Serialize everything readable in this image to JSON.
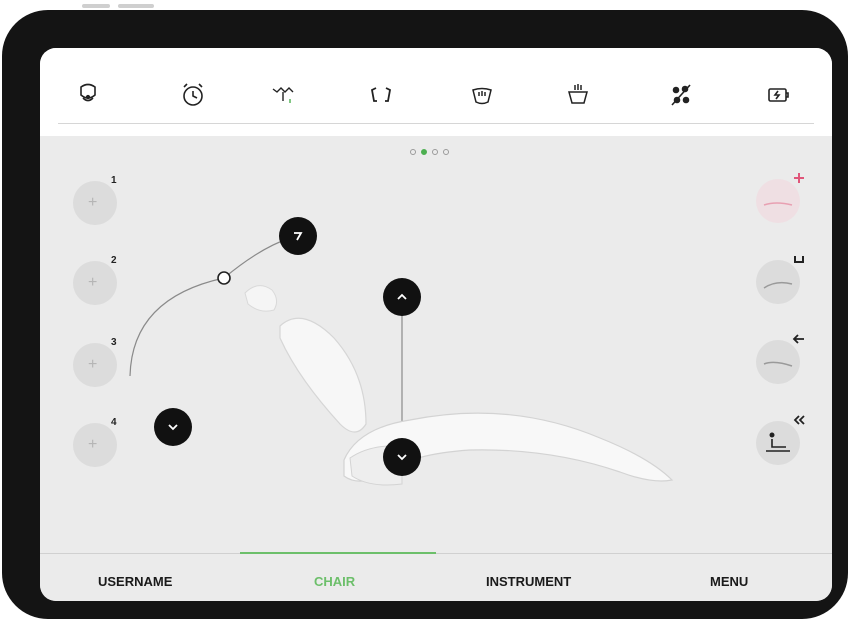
{
  "toolbar": {
    "icons": [
      "headrest-icon",
      "alarm-clock-icon",
      "tooth-light-icon",
      "bracket-icon",
      "water-cup-icon",
      "basin-rinse-icon",
      "water-spray-off-icon",
      "battery-icon"
    ]
  },
  "pager": {
    "pages": 4,
    "active_index": 1
  },
  "presets": [
    {
      "number": "1",
      "icon": "plus-icon"
    },
    {
      "number": "2",
      "icon": "plus-icon"
    },
    {
      "number": "3",
      "icon": "plus-icon"
    },
    {
      "number": "4",
      "icon": "plus-icon"
    }
  ],
  "right_actions": [
    {
      "name": "add-position",
      "badge": "+",
      "color": "#e0567a"
    },
    {
      "name": "rinse-position",
      "badge": "cup",
      "color": "#222222"
    },
    {
      "name": "exit-position",
      "badge": "arrow-left",
      "color": "#222222"
    },
    {
      "name": "reset-position",
      "badge": "double-chevron-left",
      "color": "#222222"
    }
  ],
  "tabs": [
    {
      "label": "USERNAME",
      "active": false
    },
    {
      "label": "CHAIR",
      "active": true
    },
    {
      "label": "INSTRUMENT",
      "active": false
    },
    {
      "label": "MENU",
      "active": false
    }
  ],
  "colors": {
    "accent": "#6cbf6a",
    "control": "#111111",
    "add_badge": "#e0567a"
  }
}
